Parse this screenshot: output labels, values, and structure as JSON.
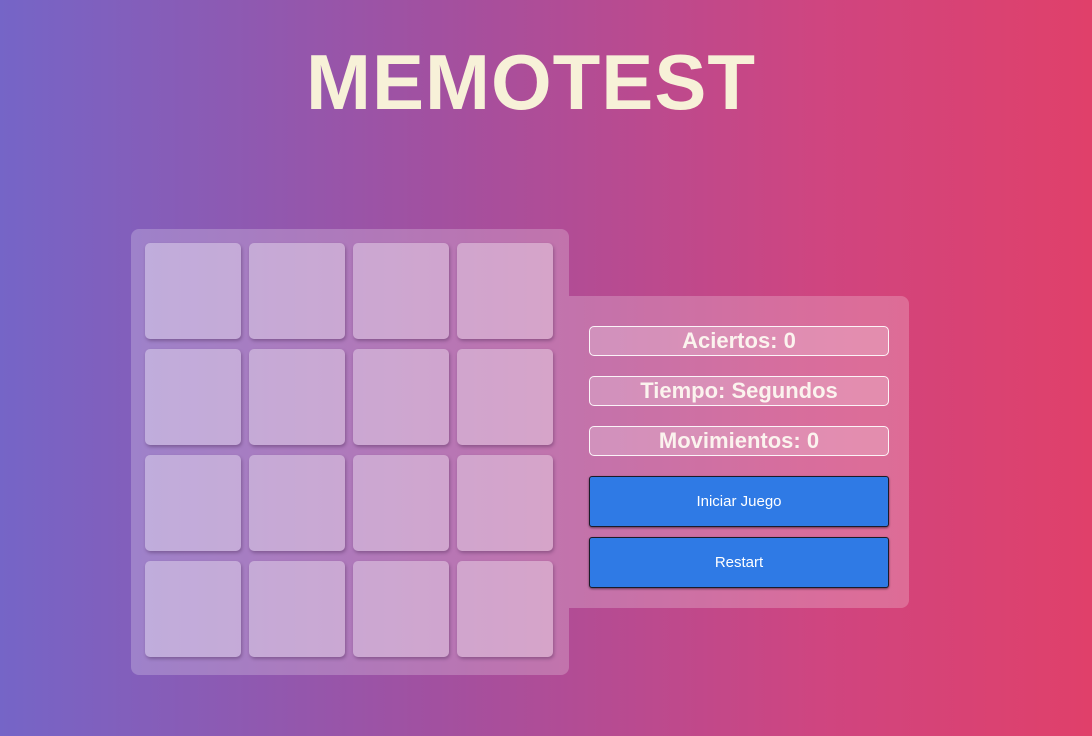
{
  "header": {
    "title": "MEMOTEST"
  },
  "board": {
    "rows": 4,
    "columns": 4,
    "cards_face_down": 16
  },
  "stats": {
    "aciertos": "Aciertos: 0",
    "tiempo": "Tiempo: Segundos",
    "movimientos": "Movimientos: 0"
  },
  "controls": {
    "start_label": "Iniciar Juego",
    "restart_label": "Restart"
  },
  "colors": {
    "background_start": "#7565c7",
    "background_end": "#e0406a",
    "title": "#f7f1d8",
    "button": "#2f7ae5"
  }
}
